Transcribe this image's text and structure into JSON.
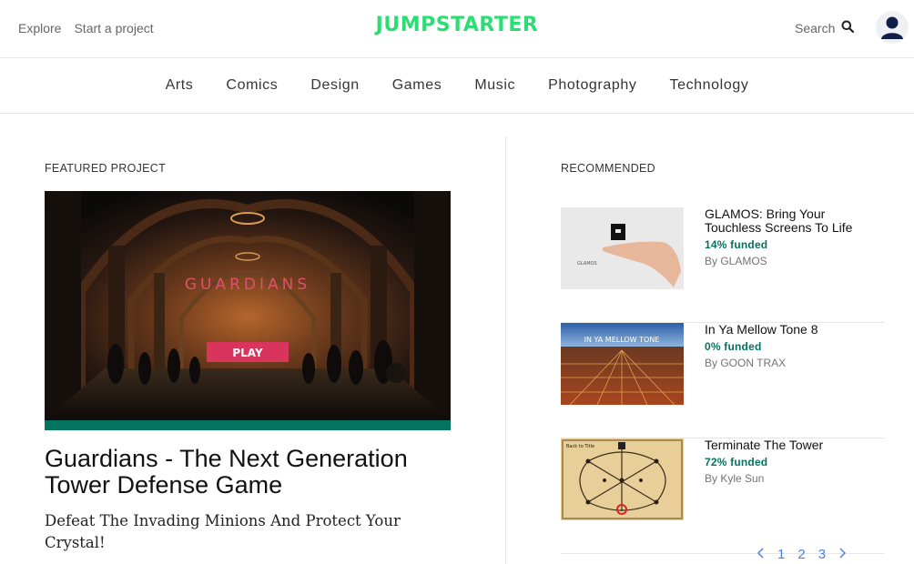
{
  "header": {
    "nav": [
      {
        "label": "Explore"
      },
      {
        "label": "Start a project"
      }
    ],
    "brand": "JUMPSTARTER",
    "search_label": "Search",
    "search_icon": "search-icon",
    "avatar_icon": "user-avatar-icon"
  },
  "categories": [
    "Arts",
    "Comics",
    "Design",
    "Games",
    "Music",
    "Photography",
    "Technology"
  ],
  "featured": {
    "section_label": "FEATURED PROJECT",
    "media_title": "GUARDIANS",
    "media_button": "PLAY",
    "progress_fraction": 1.0,
    "progress_color": "#037362",
    "title": "Guardians - The Next Generation Tower Defense Game",
    "blurb": "Defeat The Invading Minions And Protect Your Crystal!"
  },
  "recommended": {
    "section_label": "RECOMMENDED",
    "items": [
      {
        "title": "GLAMOS: Bring Your Touchless Screens To Life",
        "funded": "14% funded",
        "by": "By GLAMOS",
        "thumb_text": "GLAMOS"
      },
      {
        "title": "In Ya Mellow Tone 8",
        "funded": "0% funded",
        "by": "By GOON TRAX",
        "thumb_text": "IN YA MELLOW TONE"
      },
      {
        "title": "Terminate The Tower",
        "funded": "72% funded",
        "by": "By Kyle Sun",
        "thumb_text": "Back to Title"
      }
    ]
  },
  "pagination": {
    "prev_icon": "chevron-left-icon",
    "pages": [
      "1",
      "2",
      "3"
    ],
    "next_icon": "chevron-right-icon"
  },
  "colors": {
    "brand": "#2bde73",
    "funded": "#037362",
    "link": "#4a80de"
  }
}
